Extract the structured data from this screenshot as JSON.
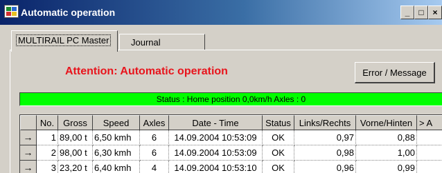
{
  "window": {
    "title": "Automatic operation",
    "minimize": "_",
    "maximize": "□",
    "close": "×"
  },
  "tabs": [
    {
      "label": "MULTIRAIL PC Master",
      "active": true
    },
    {
      "label": "Journal",
      "active": false
    }
  ],
  "attention_text": "Attention: Automatic operation",
  "error_button": "Error / Message",
  "status_text": "Status : Home position   0,0km/h Axles : 0",
  "colors": {
    "title_start": "#0a246a",
    "title_end": "#a6caf0",
    "attention": "#e8141c",
    "status_bg": "#00ff00"
  },
  "table": {
    "headers": [
      "No.",
      "Gross",
      "Speed",
      "Axles",
      "Date - Time",
      "Status",
      "Links/Rechts",
      "Vorne/Hinten",
      "> A"
    ],
    "row_marker": "→",
    "rows": [
      [
        "1",
        "89,00 t",
        "6,50 kmh",
        "6",
        "14.09.2004 10:53:09",
        "OK",
        "0,97",
        "0,88",
        ""
      ],
      [
        "2",
        "98,00 t",
        "6,30 kmh",
        "6",
        "14.09.2004 10:53:09",
        "OK",
        "0,98",
        "1,00",
        ""
      ],
      [
        "3",
        "23,20 t",
        "6,40 kmh",
        "4",
        "14.09.2004 10:53:10",
        "OK",
        "0,96",
        "0,99",
        ""
      ]
    ]
  }
}
